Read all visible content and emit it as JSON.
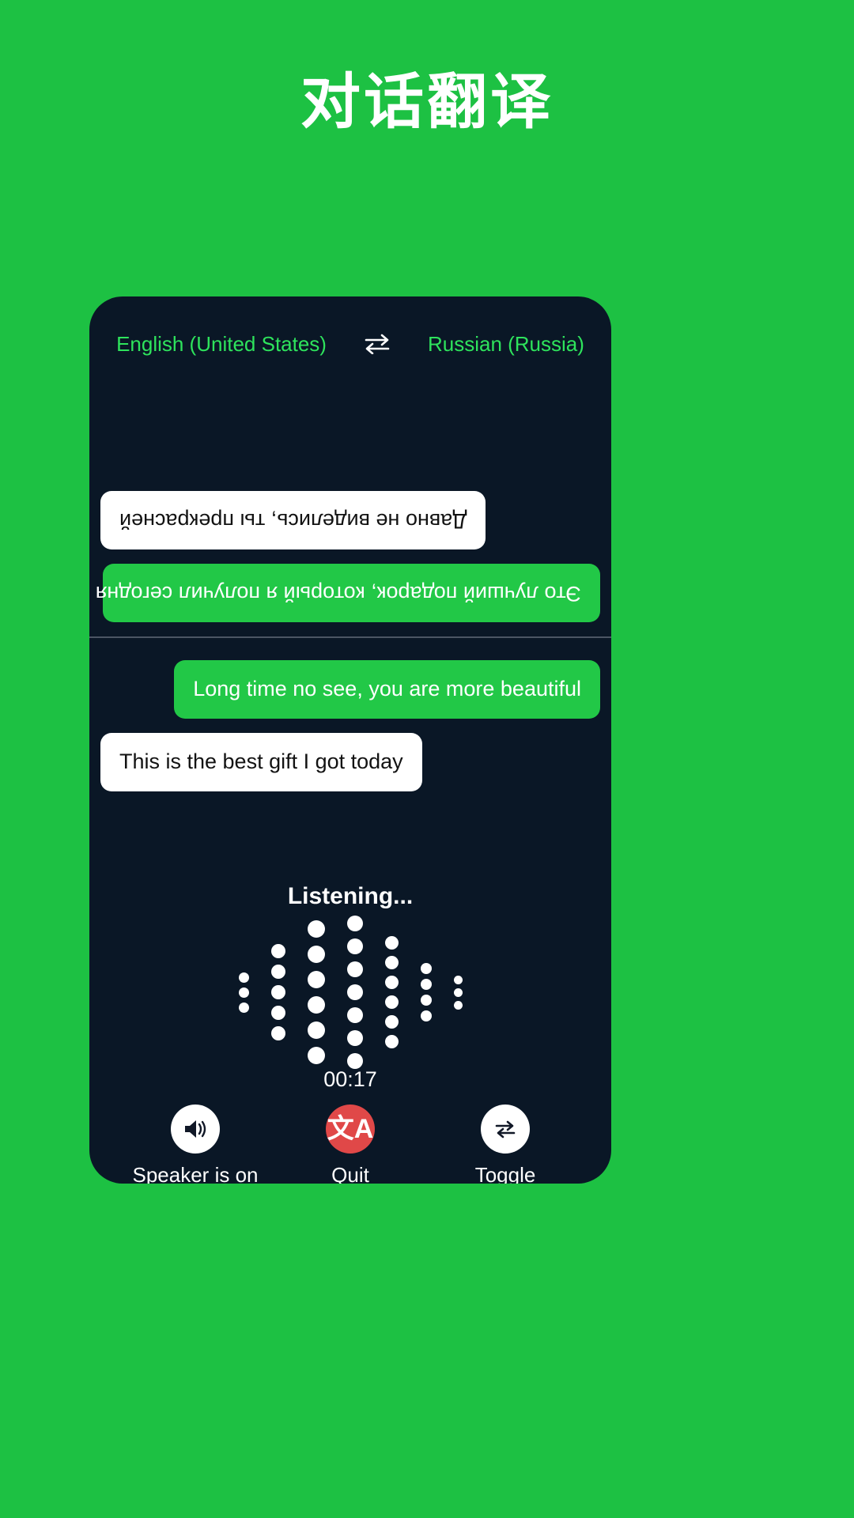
{
  "page": {
    "title": "对话翻译",
    "background_color": "#1dc143",
    "panel_color": "#0a1726",
    "accent_green": "#22c847",
    "quit_red": "#e04848"
  },
  "language_bar": {
    "source": "English (United States)",
    "swap_icon": "swap-horizontal-icon",
    "target": "Russian (Russia)"
  },
  "conversation": {
    "remote_panel": {
      "rotated": true,
      "messages": [
        {
          "text": "Это лучший подарок, который я получил сегодня",
          "style": "green",
          "align": "left"
        },
        {
          "text": "Давно не виделись, ты прекрасней",
          "style": "white",
          "align": "right"
        }
      ]
    },
    "local_panel": {
      "rotated": false,
      "messages": [
        {
          "text": "Long time no see, you are more beautiful",
          "style": "green",
          "align": "right"
        },
        {
          "text": "This is the best gift I got today",
          "style": "white",
          "align": "left"
        }
      ]
    }
  },
  "listening": {
    "status": "Listening...",
    "timer": "00:17",
    "visualizer": {
      "columns": [
        {
          "dots": 3,
          "size": 13
        },
        {
          "dots": 5,
          "size": 18
        },
        {
          "dots": 6,
          "size": 22
        },
        {
          "dots": 7,
          "size": 20
        },
        {
          "dots": 6,
          "size": 17
        },
        {
          "dots": 4,
          "size": 14
        },
        {
          "dots": 3,
          "size": 11
        }
      ]
    }
  },
  "controls": [
    {
      "icon": "speaker-on-icon",
      "label": "Speaker is on",
      "circle": "white"
    },
    {
      "icon": "translate-icon",
      "label": "Quit",
      "circle": "red",
      "glyph": "文A"
    },
    {
      "icon": "toggle-swap-icon",
      "label": "Toggle",
      "circle": "white"
    }
  ]
}
